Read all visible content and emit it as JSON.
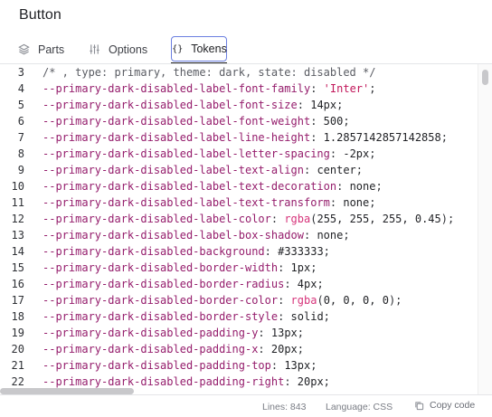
{
  "title": "Button",
  "tabs": [
    {
      "label": "Parts",
      "icon": "layers-icon"
    },
    {
      "label": "Options",
      "icon": "sliders-icon"
    },
    {
      "label": "Tokens",
      "icon": "braces-icon",
      "glyph": "{}",
      "active": true
    }
  ],
  "code": {
    "lines": [
      {
        "n": "3",
        "parts": [
          [
            "c",
            "/* , type: primary, theme: dark, state: disabled */"
          ]
        ]
      },
      {
        "n": "4",
        "parts": [
          [
            "p",
            "--primary-dark-disabled-label-font-family"
          ],
          [
            "u",
            ": "
          ],
          [
            "s",
            "'Inter'"
          ],
          [
            "u",
            ";"
          ]
        ]
      },
      {
        "n": "5",
        "parts": [
          [
            "p",
            "--primary-dark-disabled-label-font-size"
          ],
          [
            "u",
            ": "
          ],
          [
            "v",
            "14px"
          ],
          [
            "u",
            ";"
          ]
        ]
      },
      {
        "n": "6",
        "parts": [
          [
            "p",
            "--primary-dark-disabled-label-font-weight"
          ],
          [
            "u",
            ": "
          ],
          [
            "v",
            "500"
          ],
          [
            "u",
            ";"
          ]
        ]
      },
      {
        "n": "7",
        "parts": [
          [
            "p",
            "--primary-dark-disabled-label-line-height"
          ],
          [
            "u",
            ": "
          ],
          [
            "v",
            "1.2857142857142858"
          ],
          [
            "u",
            ";"
          ]
        ]
      },
      {
        "n": "8",
        "parts": [
          [
            "p",
            "--primary-dark-disabled-label-letter-spacing"
          ],
          [
            "u",
            ": "
          ],
          [
            "v",
            "-2px"
          ],
          [
            "u",
            ";"
          ]
        ]
      },
      {
        "n": "9",
        "parts": [
          [
            "p",
            "--primary-dark-disabled-label-text-align"
          ],
          [
            "u",
            ": "
          ],
          [
            "v",
            "center"
          ],
          [
            "u",
            ";"
          ]
        ]
      },
      {
        "n": "10",
        "parts": [
          [
            "p",
            "--primary-dark-disabled-label-text-decoration"
          ],
          [
            "u",
            ": "
          ],
          [
            "v",
            "none"
          ],
          [
            "u",
            ";"
          ]
        ]
      },
      {
        "n": "11",
        "parts": [
          [
            "p",
            "--primary-dark-disabled-label-text-transform"
          ],
          [
            "u",
            ": "
          ],
          [
            "v",
            "none"
          ],
          [
            "u",
            ";"
          ]
        ]
      },
      {
        "n": "12",
        "parts": [
          [
            "p",
            "--primary-dark-disabled-label-color"
          ],
          [
            "u",
            ": "
          ],
          [
            "f",
            "rgba"
          ],
          [
            "u",
            "("
          ],
          [
            "v",
            "255, 255, 255, 0.45"
          ],
          [
            "u",
            ");"
          ]
        ]
      },
      {
        "n": "13",
        "parts": [
          [
            "p",
            "--primary-dark-disabled-label-box-shadow"
          ],
          [
            "u",
            ": "
          ],
          [
            "v",
            "none"
          ],
          [
            "u",
            ";"
          ]
        ]
      },
      {
        "n": "14",
        "parts": [
          [
            "p",
            "--primary-dark-disabled-background"
          ],
          [
            "u",
            ": "
          ],
          [
            "v",
            "#333333"
          ],
          [
            "u",
            ";"
          ]
        ]
      },
      {
        "n": "15",
        "parts": [
          [
            "p",
            "--primary-dark-disabled-border-width"
          ],
          [
            "u",
            ": "
          ],
          [
            "v",
            "1px"
          ],
          [
            "u",
            ";"
          ]
        ]
      },
      {
        "n": "16",
        "parts": [
          [
            "p",
            "--primary-dark-disabled-border-radius"
          ],
          [
            "u",
            ": "
          ],
          [
            "v",
            "4px"
          ],
          [
            "u",
            ";"
          ]
        ]
      },
      {
        "n": "17",
        "parts": [
          [
            "p",
            "--primary-dark-disabled-border-color"
          ],
          [
            "u",
            ": "
          ],
          [
            "f",
            "rgba"
          ],
          [
            "u",
            "("
          ],
          [
            "v",
            "0, 0, 0, 0"
          ],
          [
            "u",
            ");"
          ]
        ]
      },
      {
        "n": "18",
        "parts": [
          [
            "p",
            "--primary-dark-disabled-border-style"
          ],
          [
            "u",
            ": "
          ],
          [
            "v",
            "solid"
          ],
          [
            "u",
            ";"
          ]
        ]
      },
      {
        "n": "19",
        "parts": [
          [
            "p",
            "--primary-dark-disabled-padding-y"
          ],
          [
            "u",
            ": "
          ],
          [
            "v",
            "13px"
          ],
          [
            "u",
            ";"
          ]
        ]
      },
      {
        "n": "20",
        "parts": [
          [
            "p",
            "--primary-dark-disabled-padding-x"
          ],
          [
            "u",
            ": "
          ],
          [
            "v",
            "20px"
          ],
          [
            "u",
            ";"
          ]
        ]
      },
      {
        "n": "21",
        "parts": [
          [
            "p",
            "--primary-dark-disabled-padding-top"
          ],
          [
            "u",
            ": "
          ],
          [
            "v",
            "13px"
          ],
          [
            "u",
            ";"
          ]
        ]
      },
      {
        "n": "22",
        "parts": [
          [
            "p",
            "--primary-dark-disabled-padding-right"
          ],
          [
            "u",
            ": "
          ],
          [
            "v",
            "20px"
          ],
          [
            "u",
            ";"
          ]
        ]
      }
    ]
  },
  "status": {
    "lines": "Lines: 843",
    "language": "Language: CSS",
    "copy_label": "Copy code",
    "copy_icon": "copy-icon"
  },
  "colors": {
    "property": "#951d6c",
    "string": "#c2185b",
    "function": "#d6337a",
    "active_tab_border": "#6b7fe0"
  }
}
